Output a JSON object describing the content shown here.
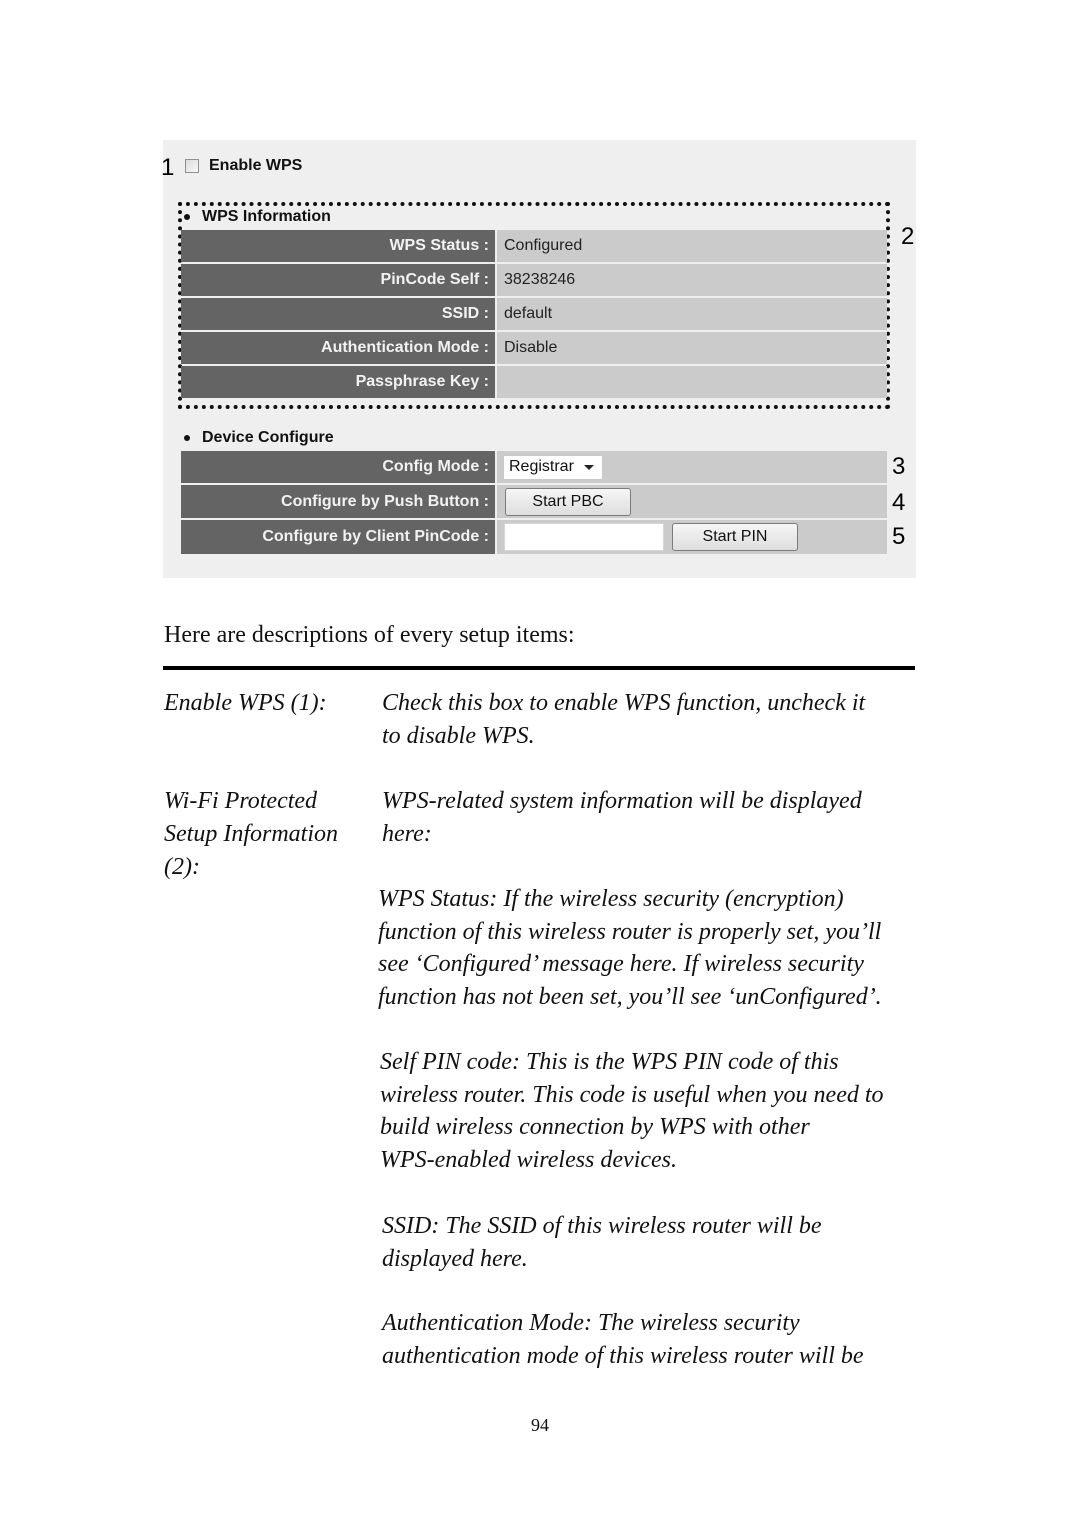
{
  "screenshot": {
    "callouts": [
      "1",
      "2",
      "3",
      "4",
      "5"
    ],
    "enable_wps": {
      "label": "Enable WPS",
      "checked": false
    },
    "wps_information": {
      "title": "WPS Information",
      "rows": [
        {
          "label": "WPS Status :",
          "value": "Configured"
        },
        {
          "label": "PinCode Self :",
          "value": "38238246"
        },
        {
          "label": "SSID :",
          "value": "default"
        },
        {
          "label": "Authentication Mode :",
          "value": "Disable"
        },
        {
          "label": "Passphrase Key :",
          "value": ""
        }
      ]
    },
    "device_configure": {
      "title": "Device Configure",
      "config_mode": {
        "label": "Config Mode :",
        "selected": "Registrar"
      },
      "push_button": {
        "label": "Configure by Push Button :",
        "button": "Start PBC"
      },
      "client_pin": {
        "label": "Configure by Client PinCode :",
        "input_value": "",
        "button": "Start PIN"
      }
    },
    "colors": {
      "panel_bg": "#efefef",
      "label_bg": "#646464",
      "value_bg": "#cbcbcb"
    }
  },
  "document": {
    "intro": "Here are descriptions of every setup items:",
    "items": [
      {
        "term": "Enable WPS (1):",
        "paragraphs": [
          "Check this box to enable WPS function, uncheck it\nto disable WPS."
        ]
      },
      {
        "term": "Wi-Fi Protected\nSetup Information\n(2):",
        "paragraphs": [
          "WPS-related system information will be displayed\nhere:",
          "WPS Status: If the wireless security (encryption)\nfunction of this wireless router is properly set, you’ll\nsee ‘Configured’ message here. If wireless security\nfunction has not been set, you’ll see ‘unConfigured’.",
          "Self PIN code: This is the WPS PIN code of this\nwireless router. This code is useful when you need to\nbuild wireless connection by WPS with other\nWPS-enabled wireless devices.",
          "SSID: The SSID of this wireless router will be\ndisplayed here.",
          "Authentication Mode: The wireless security\nauthentication mode of this wireless router will be"
        ]
      }
    ],
    "page_number": "94"
  }
}
